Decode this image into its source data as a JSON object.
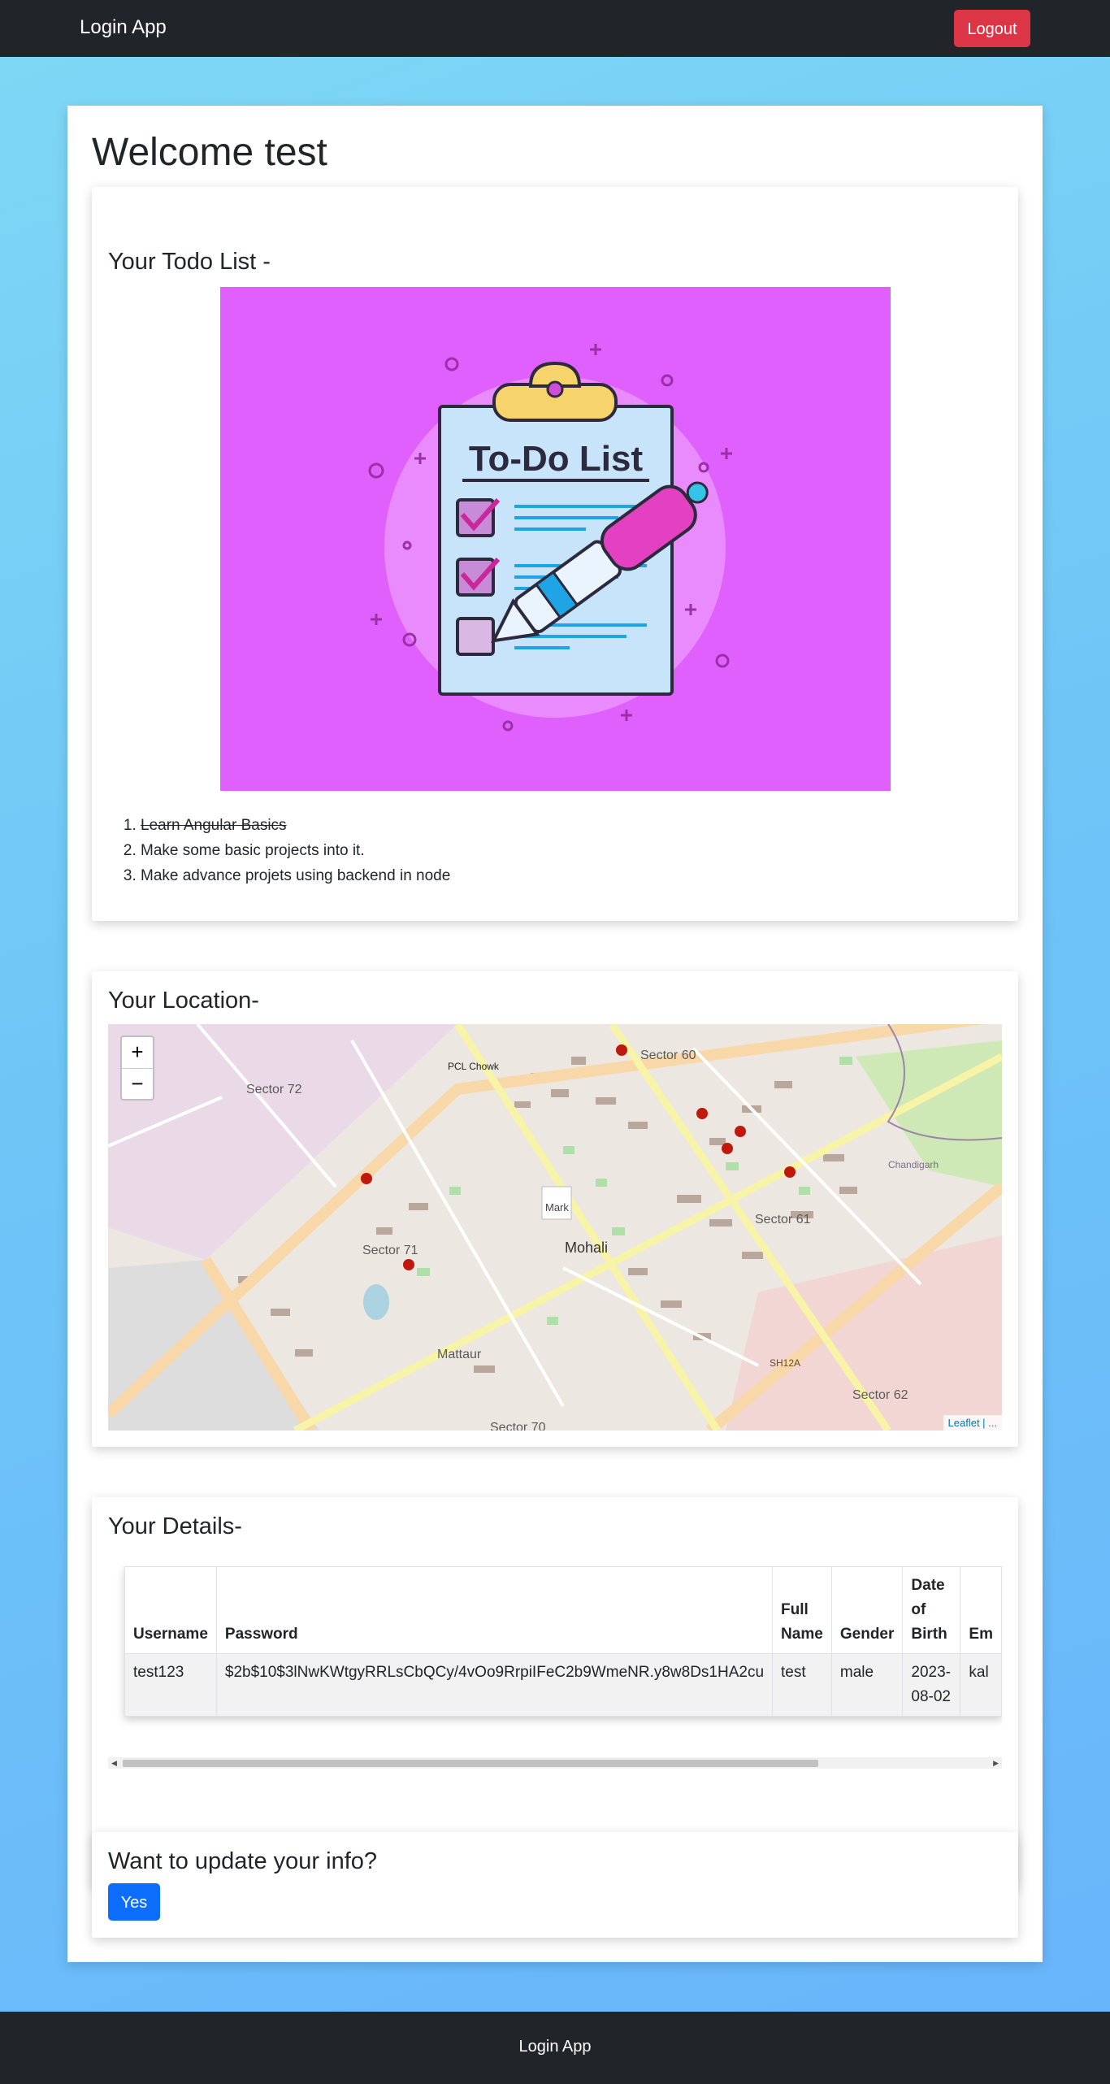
{
  "navbar": {
    "brand": "Login App",
    "logout_label": "Logout"
  },
  "welcome": "Welcome test",
  "todo": {
    "heading": "Your Todo List -",
    "image_title": "To-Do List",
    "items": [
      {
        "text": "Learn Angular Basics",
        "done": true
      },
      {
        "text": "Make some basic projects into it.",
        "done": false
      },
      {
        "text": "Make advance projets using backend in node",
        "done": false
      }
    ]
  },
  "location": {
    "heading": "Your Location-",
    "zoom_in": "+",
    "zoom_out": "−",
    "attribution": "Leaflet | ...",
    "marker_alt": "Mark",
    "labels": [
      "Sector 72",
      "PCL Chowk",
      "Sector 60",
      "Sector 71",
      "Mohali",
      "Sector 61",
      "Mattaur",
      "Sector 62",
      "SH12A",
      "Sector 70",
      "Chandigarh"
    ]
  },
  "details": {
    "heading": "Your Details-",
    "columns": [
      "Username",
      "Password",
      "Full Name",
      "Gender",
      "Date of Birth",
      "Em"
    ],
    "rows": [
      [
        "test123",
        "$2b$10$3lNwKWtgyRRLsCbQCy/4vOo9RrpiIFeC2b9WmeNR.y8w8Ds1HA2cu",
        "test",
        "male",
        "2023-08-02",
        "kal"
      ]
    ]
  },
  "update": {
    "heading": "Want to update your info?",
    "yes_label": "Yes"
  },
  "footer": {
    "text": "Login App"
  },
  "colors": {
    "navbar": "#212529",
    "logout": "#dc3545",
    "primary": "#0d6efd",
    "todo_bg": "#e060fd"
  }
}
